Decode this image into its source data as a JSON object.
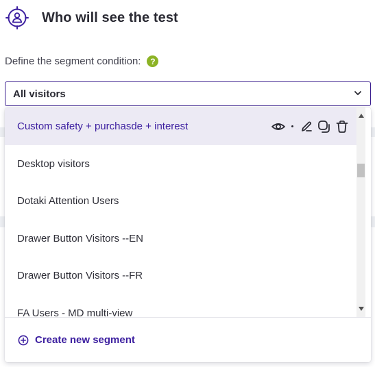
{
  "header": {
    "title": "Who will see the test",
    "icon": "target-user-icon"
  },
  "condition": {
    "label": "Define the segment condition:",
    "help": "?"
  },
  "select": {
    "value": "All visitors"
  },
  "dropdown": {
    "items": [
      {
        "label": "Custom safety + purchasde + interest",
        "active": true
      },
      {
        "label": "Desktop visitors"
      },
      {
        "label": "Dotaki Attention Users"
      },
      {
        "label": "Drawer Button Visitors --EN"
      },
      {
        "label": "Drawer Button Visitors --FR"
      },
      {
        "label": "FA Users - MD multi-view"
      }
    ],
    "actions": [
      "eye-icon",
      "pencil-icon",
      "duplicate-icon",
      "trash-icon"
    ],
    "create_label": "Create new segment"
  },
  "colors": {
    "accent": "#3d20a0",
    "help": "#8cb325",
    "active_bg": "#eceaf4"
  }
}
